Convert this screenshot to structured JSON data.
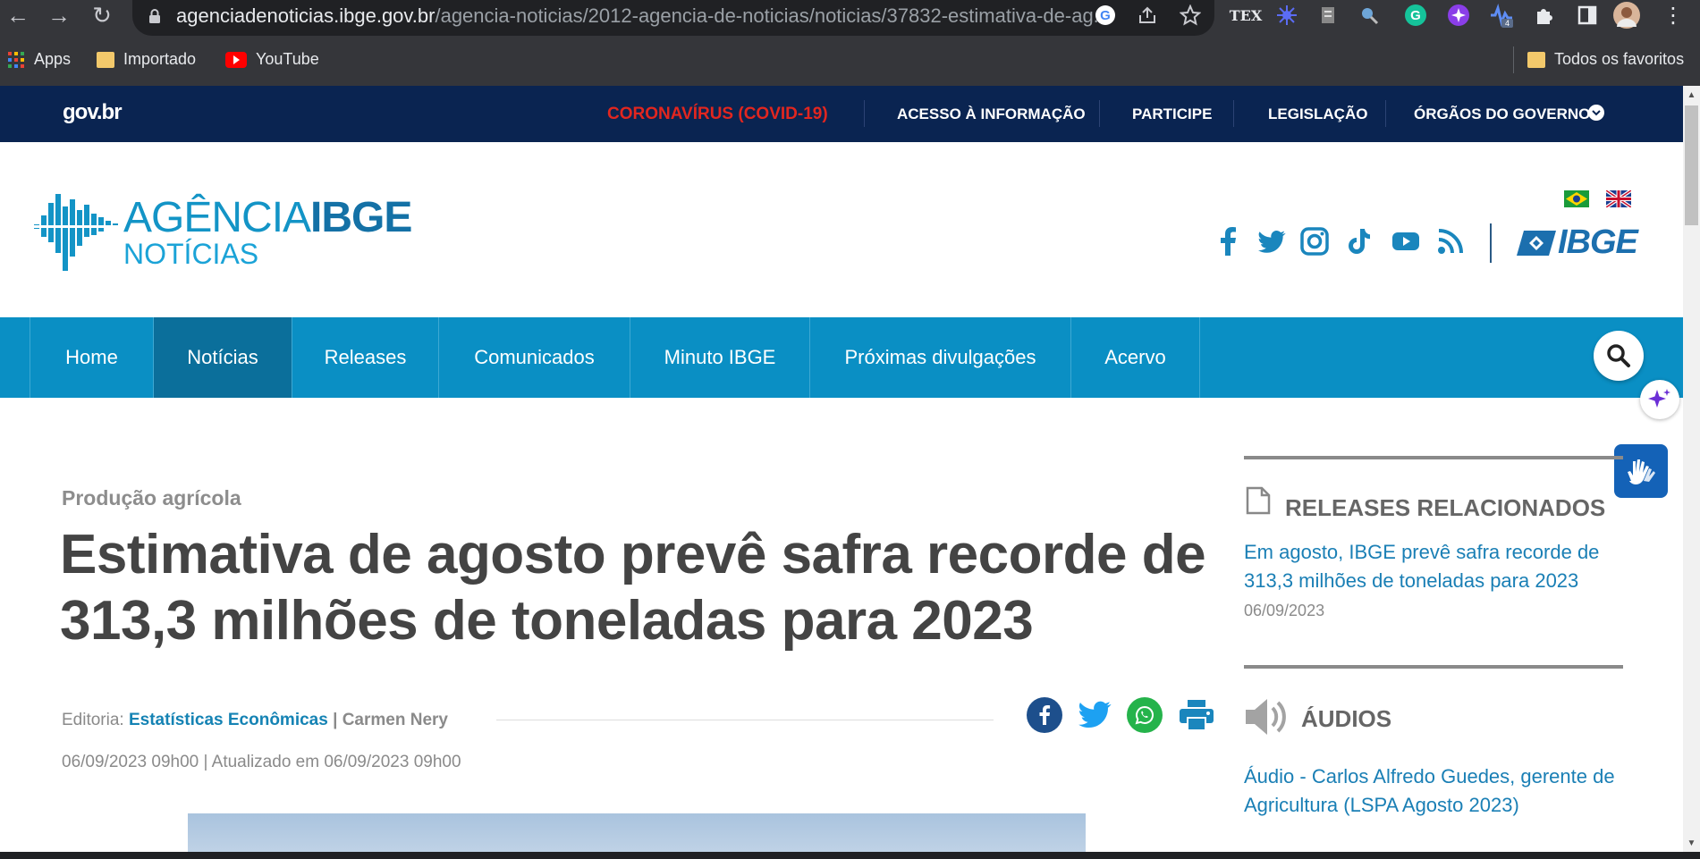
{
  "browser": {
    "url_host": "agenciadenoticias.ibge.gov.br",
    "url_path": "/agencia-noticias/2012-agencia-de-noticias/noticias/37832-estimativa-de-ag...",
    "bookmarks": [
      {
        "label": "Apps"
      },
      {
        "label": "Importado"
      },
      {
        "label": "YouTube"
      }
    ],
    "all_bookmarks": "Todos os favoritos",
    "ext_badge": "4"
  },
  "govbar": {
    "logo": "gov.br",
    "links": [
      "CORONAVÍRUS (COVID-19)",
      "ACESSO À INFORMAÇÃO",
      "PARTICIPE",
      "LEGISLAÇÃO",
      "ÓRGÃOS DO GOVERNO"
    ]
  },
  "header": {
    "logo_line1_a": "AGÊNCIA",
    "logo_line1_b": "IBGE",
    "logo_line2": "NOTÍCIAS",
    "brand": "IBGE"
  },
  "nav": {
    "items": [
      "Home",
      "Notícias",
      "Releases",
      "Comunicados",
      "Minuto IBGE",
      "Próximas divulgações",
      "Acervo"
    ],
    "active": "Notícias"
  },
  "article": {
    "category": "Produção agrícola",
    "title": "Estimativa de agosto prevê safra recorde de 313,3 milhões de toneladas para 2023",
    "editoria_label": "Editoria:",
    "editoria": "Estatísticas Econômicas",
    "separator": "|",
    "author": "Carmen Nery",
    "date": "06/09/2023 09h00 | Atualizado em 06/09/2023 09h00"
  },
  "sidebar": {
    "releases_title": "RELEASES RELACIONADOS",
    "release_link": "Em agosto, IBGE prevê safra recorde de 313,3 milhões de toneladas para 2023",
    "release_date": "06/09/2023",
    "audios_title": "ÁUDIOS",
    "audio_link": "Áudio - Carlos Alfredo Guedes, gerente de Agricultura (LSPA Agosto 2023)"
  },
  "colors": {
    "govbar": "#0a2451",
    "nav": "#0a8fc4",
    "nav_active": "#0b6f9b",
    "link": "#1a7fb5",
    "covid": "#e2261f"
  }
}
